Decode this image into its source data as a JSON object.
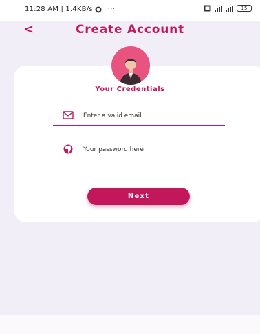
{
  "status_bar": {
    "time_speed": "11:28 AM | 1.4KB/s",
    "more": "···",
    "battery": "15"
  },
  "header": {
    "back_label": "<",
    "title": "Create Account"
  },
  "credentials": {
    "section_title": "Your Credentials",
    "email_placeholder": "Enter a valid email",
    "password_placeholder": "Your password here"
  },
  "actions": {
    "next_label": "Next"
  },
  "colors": {
    "accent": "#c2185b",
    "avatar_bg": "#e8537f",
    "background": "#f1eef7",
    "card": "#ffffff"
  },
  "icons": {
    "status": [
      "whatsapp-icon",
      "sim-icon",
      "signal-icon",
      "signal-icon",
      "battery-icon"
    ],
    "email": "envelope-icon",
    "password": "shield-icon",
    "avatar": "user-avatar-icon"
  }
}
